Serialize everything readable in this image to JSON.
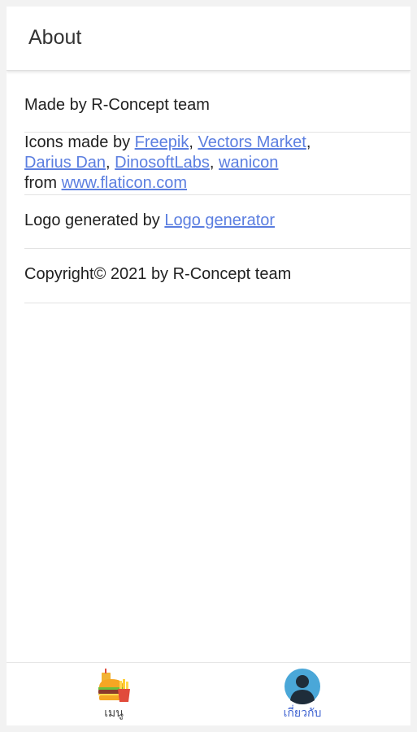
{
  "header": {
    "title": "About"
  },
  "rows": {
    "made_by": "Made by R-Concept team",
    "icons": {
      "prefix": "Icons made by ",
      "links": [
        "Freepik",
        "Vectors Market",
        "Darius Dan",
        "DinosoftLabs",
        "wanicon"
      ],
      "from_text": "from ",
      "site_link": "www.flaticon.com"
    },
    "logo": {
      "prefix": "Logo generated by ",
      "link": "Logo generator"
    },
    "copyright": "Copyright© 2021 by R-Concept team"
  },
  "bottom_nav": {
    "items": [
      {
        "label": "เมนู",
        "icon": "food-menu-icon",
        "active": false
      },
      {
        "label": "เกี่ยวกับ",
        "icon": "user-avatar-icon",
        "active": true
      }
    ]
  },
  "colors": {
    "link": "#5b7ee0",
    "active_nav": "#3a5fd0",
    "avatar_bg": "#4aa7d8",
    "divider": "#e3e3e3"
  }
}
